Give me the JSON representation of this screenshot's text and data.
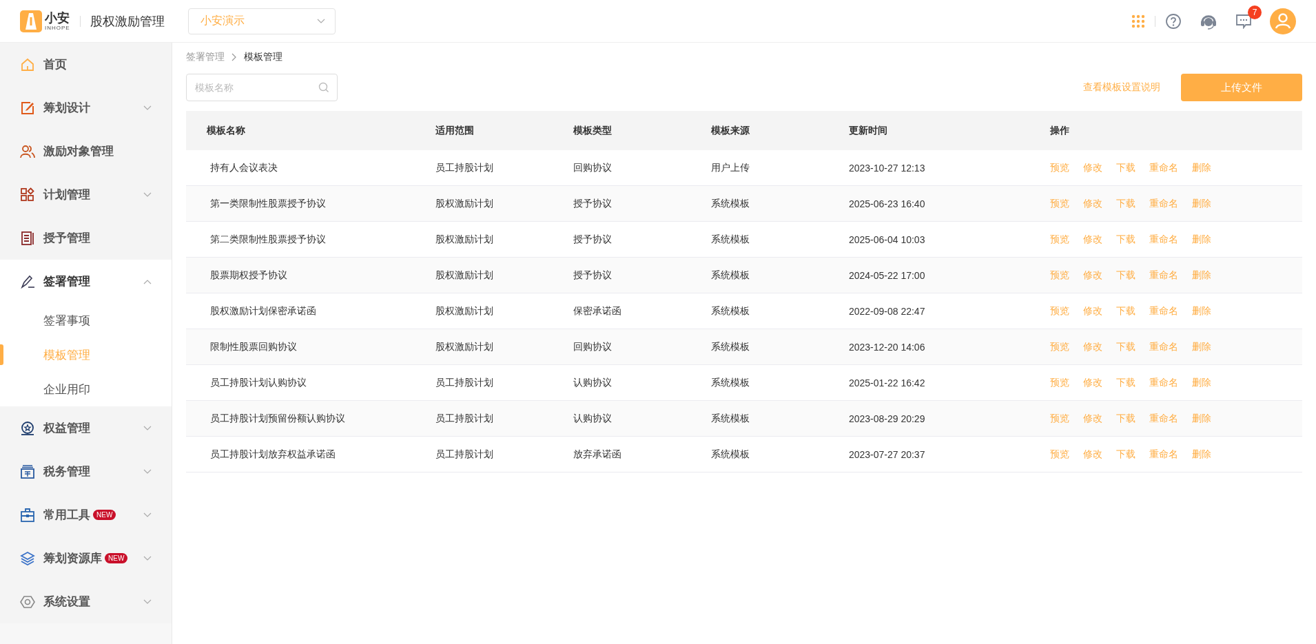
{
  "header": {
    "logo_text": "小安",
    "logo_subtext": "INHOPE",
    "app_title": "股权激励管理",
    "org_select": {
      "value": "小安演示"
    },
    "notification_count": "7"
  },
  "sidebar": {
    "items": [
      {
        "label": "首页",
        "has_arrow": false,
        "expanded": false
      },
      {
        "label": "筹划设计",
        "has_arrow": true,
        "expanded": false
      },
      {
        "label": "激励对象管理",
        "has_arrow": false,
        "expanded": false
      },
      {
        "label": "计划管理",
        "has_arrow": true,
        "expanded": false
      },
      {
        "label": "授予管理",
        "has_arrow": false,
        "expanded": false
      },
      {
        "label": "签署管理",
        "has_arrow": true,
        "expanded": true,
        "children": [
          {
            "label": "签署事项",
            "selected": false
          },
          {
            "label": "模板管理",
            "selected": true
          },
          {
            "label": "企业用印",
            "selected": false
          }
        ]
      },
      {
        "label": "权益管理",
        "has_arrow": true,
        "expanded": false
      },
      {
        "label": "税务管理",
        "has_arrow": true,
        "expanded": false
      },
      {
        "label": "常用工具",
        "has_arrow": true,
        "expanded": false,
        "badge": "NEW"
      },
      {
        "label": "筹划资源库",
        "has_arrow": true,
        "expanded": false,
        "badge": "NEW"
      },
      {
        "label": "系统设置",
        "has_arrow": true,
        "expanded": false
      }
    ]
  },
  "breadcrumb": [
    "签署管理",
    "模板管理"
  ],
  "search": {
    "placeholder": "模板名称"
  },
  "help_link": "查看模板设置说明",
  "upload_button": "上传文件",
  "table": {
    "columns": [
      "模板名称",
      "适用范围",
      "模板类型",
      "模板来源",
      "更新时间",
      "操作"
    ],
    "rows": [
      {
        "cells": [
          "持有人会议表决",
          "员工持股计划",
          "回购协议",
          "用户上传",
          "2023-10-27 12:13"
        ],
        "actions": [
          "预览",
          "修改",
          "下载",
          "重命名",
          "删除"
        ]
      },
      {
        "cells": [
          "第一类限制性股票授予协议",
          "股权激励计划",
          "授予协议",
          "系统模板",
          "2025-06-23 16:40"
        ],
        "actions": [
          "预览",
          "修改",
          "下载",
          "重命名",
          "删除"
        ]
      },
      {
        "cells": [
          "第二类限制性股票授予协议",
          "股权激励计划",
          "授予协议",
          "系统模板",
          "2025-06-04 10:03"
        ],
        "actions": [
          "预览",
          "修改",
          "下载",
          "重命名",
          "删除"
        ]
      },
      {
        "cells": [
          "股票期权授予协议",
          "股权激励计划",
          "授予协议",
          "系统模板",
          "2024-05-22 17:00"
        ],
        "actions": [
          "预览",
          "修改",
          "下载",
          "重命名",
          "删除"
        ]
      },
      {
        "cells": [
          "股权激励计划保密承诺函",
          "股权激励计划",
          "保密承诺函",
          "系统模板",
          "2022-09-08 22:47"
        ],
        "actions": [
          "预览",
          "修改",
          "下载",
          "重命名",
          "删除"
        ]
      },
      {
        "cells": [
          "限制性股票回购协议",
          "股权激励计划",
          "回购协议",
          "系统模板",
          "2023-12-20 14:06"
        ],
        "actions": [
          "预览",
          "修改",
          "下载",
          "重命名",
          "删除"
        ]
      },
      {
        "cells": [
          "员工持股计划认购协议",
          "员工持股计划",
          "认购协议",
          "系统模板",
          "2025-01-22 16:42"
        ],
        "actions": [
          "预览",
          "修改",
          "下载",
          "重命名",
          "删除"
        ]
      },
      {
        "cells": [
          "员工持股计划预留份额认购协议",
          "员工持股计划",
          "认购协议",
          "系统模板",
          "2023-08-29 20:29"
        ],
        "actions": [
          "预览",
          "修改",
          "下载",
          "重命名",
          "删除"
        ]
      },
      {
        "cells": [
          "员工持股计划放弃权益承诺函",
          "员工持股计划",
          "放弃承诺函",
          "系统模板",
          "2023-07-27 20:37"
        ],
        "actions": [
          "预览",
          "修改",
          "下载",
          "重命名",
          "删除"
        ]
      }
    ]
  }
}
